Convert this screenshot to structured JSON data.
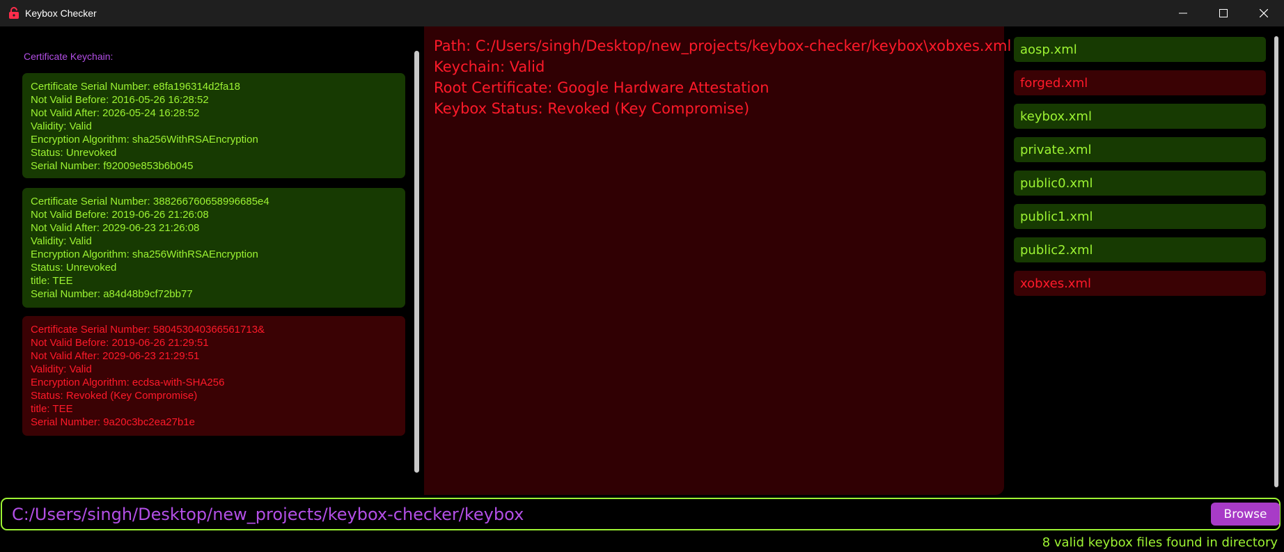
{
  "window": {
    "title": "Keybox Checker",
    "icon": "lock-icon",
    "controls": [
      "minimize-icon",
      "maximize-icon",
      "close-icon"
    ]
  },
  "left_panel": {
    "title": "Certificate Keychain:",
    "certificates": [
      {
        "status_class": "valid",
        "lines": [
          "Certificate Serial Number: e8fa196314d2fa18",
          "Not Valid Before: 2016-05-26 16:28:52",
          "Not Valid After: 2026-05-24 16:28:52",
          "Validity: Valid",
          "Encryption Algorithm: sha256WithRSAEncryption",
          "Status: Unrevoked",
          "Serial Number: f92009e853b6b045"
        ]
      },
      {
        "status_class": "valid",
        "lines": [
          "Certificate Serial Number: 388266760658996685e4",
          "Not Valid Before: 2019-06-26 21:26:08",
          "Not Valid After: 2029-06-23 21:26:08",
          "Validity: Valid",
          "Encryption Algorithm: sha256WithRSAEncryption",
          "Status: Unrevoked",
          "title: TEE",
          "Serial Number: a84d48b9cf72bb77"
        ]
      },
      {
        "status_class": "revoked",
        "lines": [
          "Certificate Serial Number: 580453040366561713&",
          "Not Valid Before: 2019-06-26 21:29:51",
          "Not Valid After: 2029-06-23 21:29:51",
          "Validity: Valid",
          "Encryption Algorithm: ecdsa-with-SHA256",
          "Status: Revoked (Key Compromise)",
          "title: TEE",
          "Serial Number: 9a20c3bc2ea27b1e"
        ]
      }
    ]
  },
  "details": {
    "path": "Path: C:/Users/singh/Desktop/new_projects/keybox-checker/keybox\\xobxes.xml",
    "keychain": "Keychain: Valid",
    "root_certificate": "Root Certificate: Google Hardware Attestation",
    "keybox_status": "Keybox Status: Revoked (Key Compromise)"
  },
  "files": [
    {
      "name": "aosp.xml",
      "status_class": "valid"
    },
    {
      "name": "forged.xml",
      "status_class": "revoked"
    },
    {
      "name": "keybox.xml",
      "status_class": "valid"
    },
    {
      "name": "private.xml",
      "status_class": "valid"
    },
    {
      "name": "public0.xml",
      "status_class": "valid"
    },
    {
      "name": "public1.xml",
      "status_class": "valid"
    },
    {
      "name": "public2.xml",
      "status_class": "valid"
    },
    {
      "name": "xobxes.xml",
      "status_class": "revoked"
    }
  ],
  "path_bar": {
    "value": "C:/Users/singh/Desktop/new_projects/keybox-checker/keybox",
    "browse_label": "Browse"
  },
  "status": "8 valid keybox files found in directory",
  "colors": {
    "valid_text": "#9df433",
    "valid_bg": "#173a02",
    "revoked_text": "#ff1a2a",
    "revoked_bg": "#3a0204",
    "accent": "#b34fe6"
  }
}
